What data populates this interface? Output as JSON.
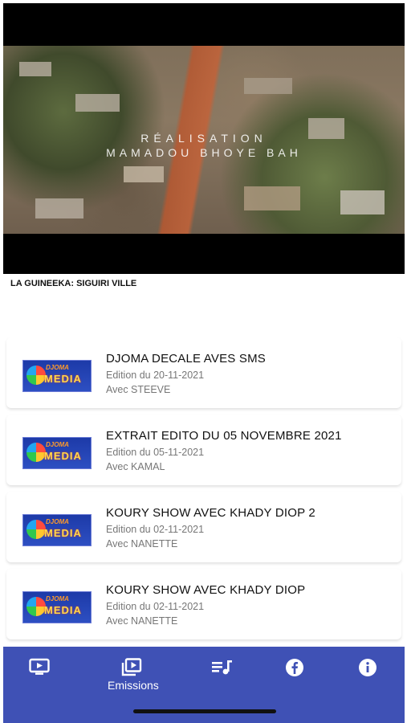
{
  "video": {
    "caption_line1": "RÉALISATION",
    "caption_line2": "MAMADOU BHOYE BAH",
    "title": "LA GUINEEKA: SIGUIRI VILLE"
  },
  "episodes": [
    {
      "title": "DJOMA DECALE AVES SMS",
      "date": "Edition du 20-11-2021",
      "host": "Avec STEEVE"
    },
    {
      "title": "EXTRAIT EDITO DU 05 NOVEMBRE 2021",
      "date": "Edition du 05-11-2021",
      "host": "Avec KAMAL"
    },
    {
      "title": "KOURY SHOW AVEC KHADY DIOP 2",
      "date": "Edition du 02-11-2021",
      "host": "Avec NANETTE"
    },
    {
      "title": "KOURY SHOW AVEC KHADY DIOP",
      "date": "Edition du 02-11-2021",
      "host": "Avec NANETTE"
    }
  ],
  "logo": {
    "line1": "DJOMA",
    "line2": "MEDIA"
  },
  "nav": {
    "items": [
      {
        "icon": "tv-icon",
        "label": ""
      },
      {
        "icon": "video-library-icon",
        "label": "Emissions"
      },
      {
        "icon": "music-playlist-icon",
        "label": ""
      },
      {
        "icon": "facebook-icon",
        "label": ""
      },
      {
        "icon": "info-icon",
        "label": ""
      }
    ],
    "active_index": 1,
    "background": "#3f51b5"
  }
}
